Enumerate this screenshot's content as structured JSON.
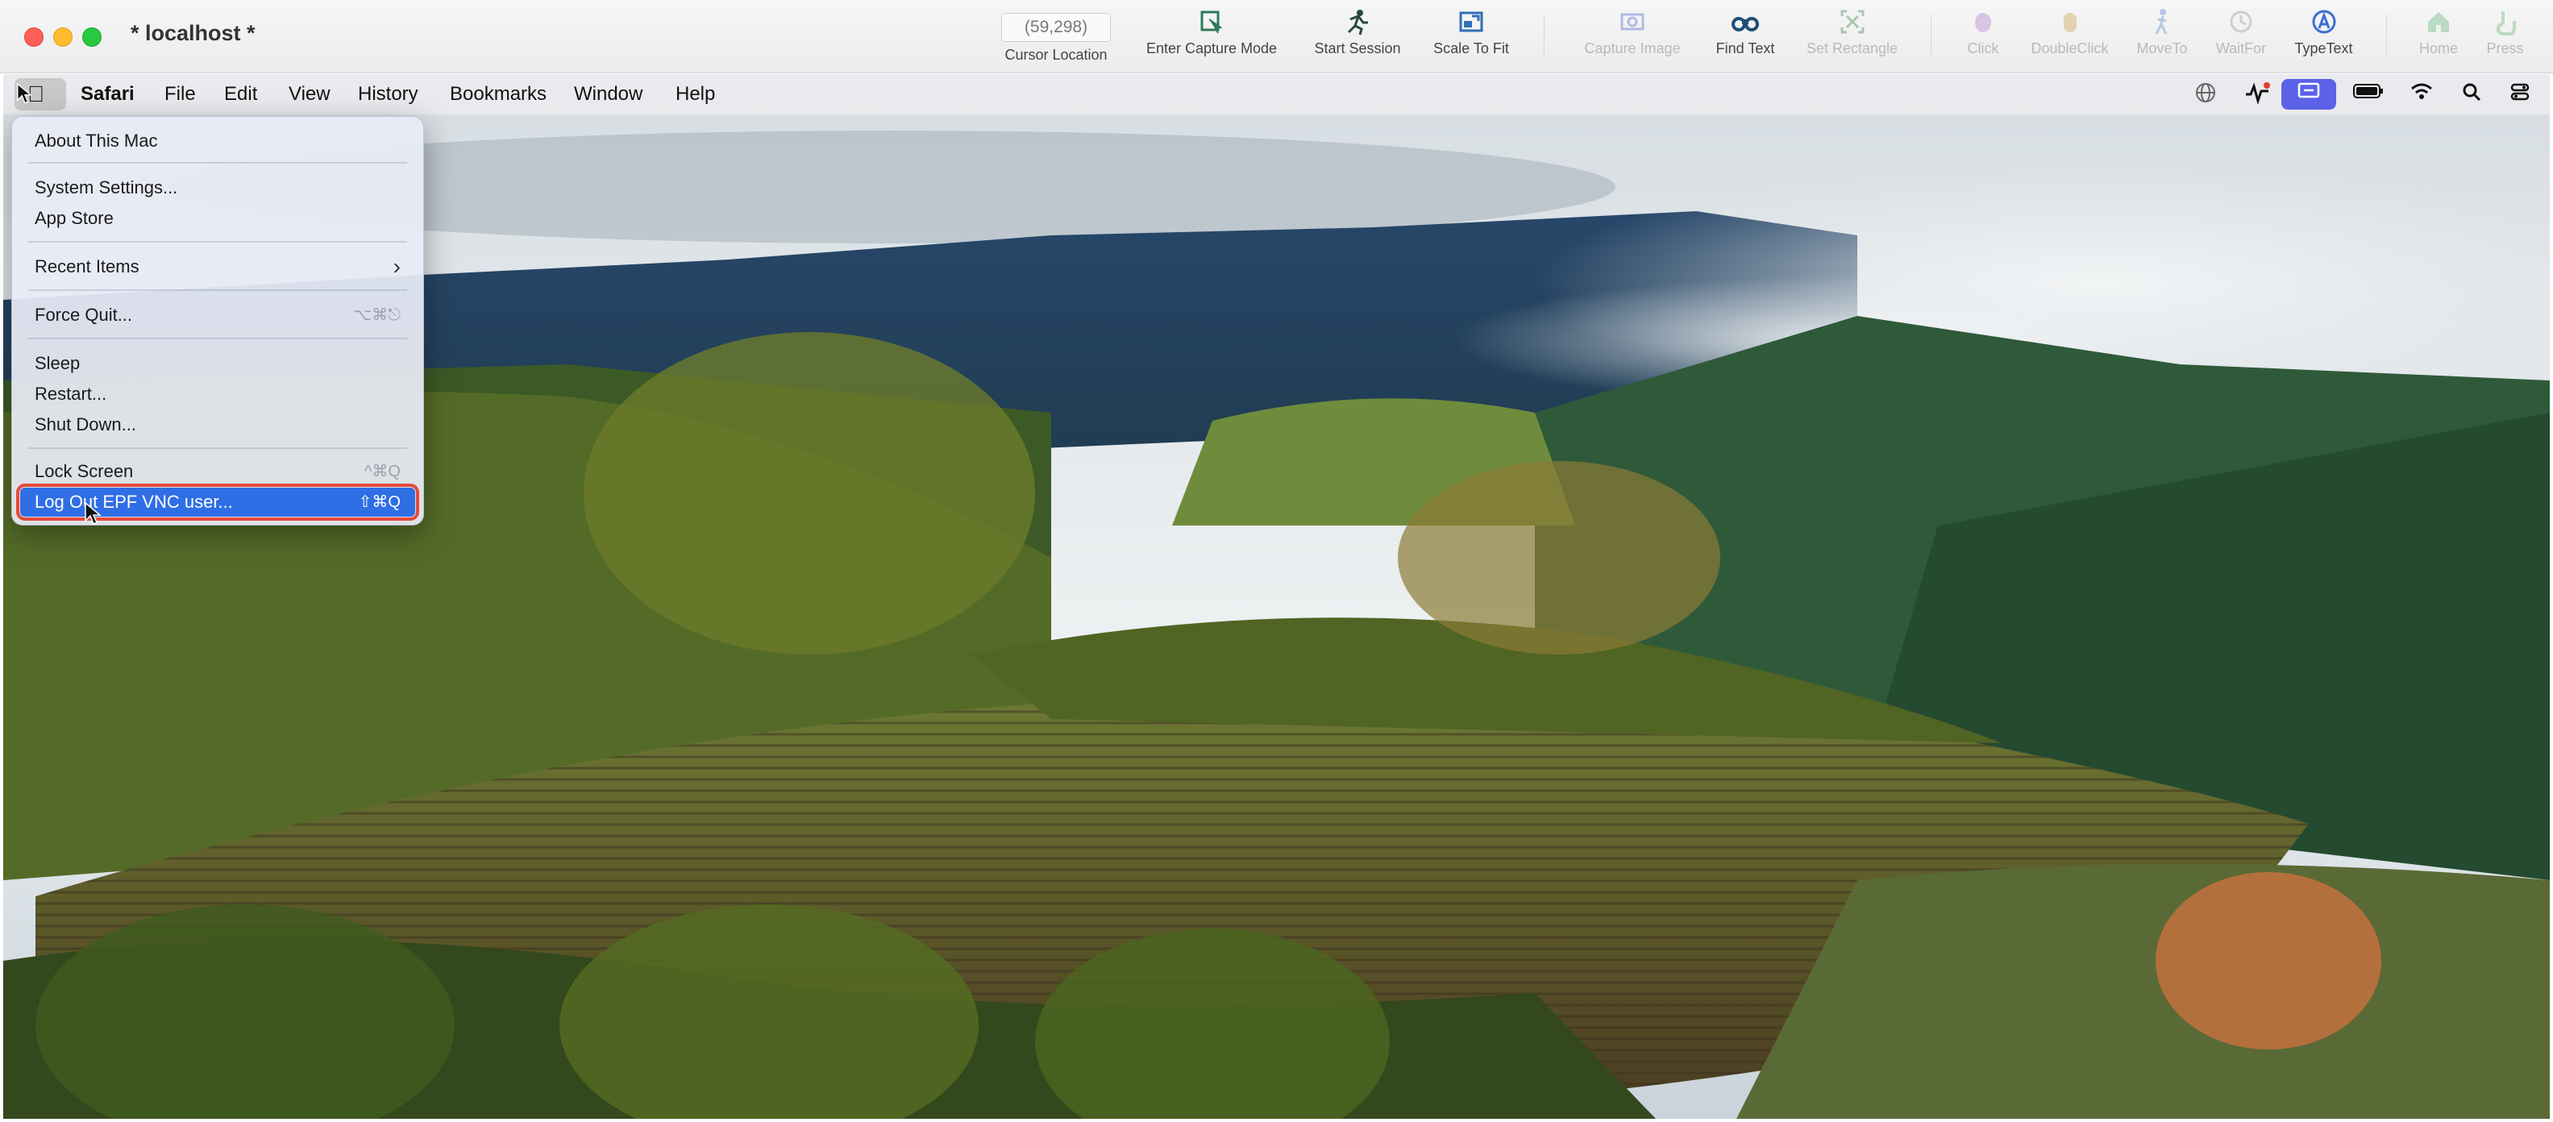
{
  "window": {
    "title": "* localhost *"
  },
  "toolbar": {
    "cursor_location": {
      "value": "(59,298)",
      "label": "Cursor Location"
    },
    "enter_capture_mode": "Enter Capture Mode",
    "start_session": "Start Session",
    "scale_to_fit": "Scale To Fit",
    "capture_image": "Capture Image",
    "find_text": "Find Text",
    "set_rectangle": "Set Rectangle",
    "click": "Click",
    "double_click": "DoubleClick",
    "move_to": "MoveTo",
    "wait_for": "WaitFor",
    "type_text": "TypeText",
    "home": "Home",
    "press": "Press"
  },
  "menubar": {
    "apple_icon": "apple-icon",
    "app_name": "Safari",
    "items": [
      "File",
      "Edit",
      "View",
      "History",
      "Bookmarks",
      "Window",
      "Help"
    ]
  },
  "apple_menu": {
    "items": [
      {
        "label": "About This Mac",
        "shortcut": ""
      },
      {
        "label": "System Settings...",
        "shortcut": ""
      },
      {
        "label": "App Store",
        "shortcut": ""
      },
      {
        "label": "Recent Items",
        "shortcut": "›"
      },
      {
        "label": "Force Quit...",
        "shortcut": "⌥⌘⎋"
      },
      {
        "label": "Sleep",
        "shortcut": ""
      },
      {
        "label": "Restart...",
        "shortcut": ""
      },
      {
        "label": "Shut Down...",
        "shortcut": ""
      },
      {
        "label": "Lock Screen",
        "shortcut": "^⌘Q"
      },
      {
        "label": "Log Out EPF VNC user...",
        "shortcut": "⇧⌘Q"
      }
    ],
    "selected_index": 9
  },
  "colors": {
    "menu_highlight": "#2f6ee5",
    "selection_outline": "#e7493b",
    "status_active": "#5b62e8"
  }
}
